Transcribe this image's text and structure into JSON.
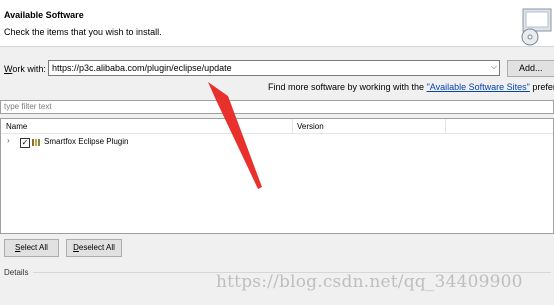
{
  "header": {
    "title": "Available Software",
    "description": "Check the items that you wish to install."
  },
  "work_with": {
    "label_mnemonic": "W",
    "label_rest": "ork with:",
    "value": "https://p3c.alibaba.com/plugin/eclipse/update",
    "add_label": "Add..."
  },
  "find_more": {
    "prefix": "Find more software by working with the ",
    "link": "\"Available Software Sites\"",
    "suffix": " preference"
  },
  "filter": {
    "placeholder": "type filter text"
  },
  "table": {
    "columns": [
      "Name",
      "Version"
    ],
    "rows": [
      {
        "name": "Smartfox Eclipse Plugin",
        "version": "",
        "checked": true
      }
    ]
  },
  "buttons": {
    "select_all_mnemonic": "S",
    "select_all_rest": "elect All",
    "deselect_all_mnemonic": "D",
    "deselect_all_rest": "eselect All"
  },
  "details": {
    "label": "Details"
  },
  "watermark": "https://blog.csdn.net/qq_34409900",
  "colors": {
    "arrow": "#e8312c",
    "link": "#0645ad"
  }
}
